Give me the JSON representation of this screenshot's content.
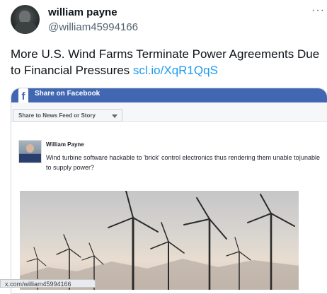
{
  "tweet": {
    "author_name": "william payne",
    "author_handle": "@william45994166",
    "more_icon": "more-horizontal-icon",
    "text": "More U.S. Wind Farms Terminate Power Agreements Due to Financial Pressures ",
    "link": "scl.io/XqR1QqS"
  },
  "facebook_embed": {
    "header_title": "Share on Facebook",
    "logo_glyph": "f",
    "share_select": "Share to News Feed or Story",
    "user_name": "William Payne",
    "post_text": "Wind turbine software hackable to 'brick' control electronics thus rendering them unable to|unable to supply power?"
  },
  "status_url": "x.com/william45994166",
  "colors": {
    "link": "#1d9bf0",
    "facebook_blue": "#4267b2",
    "text": "#0f1419",
    "secondary": "#536471"
  }
}
